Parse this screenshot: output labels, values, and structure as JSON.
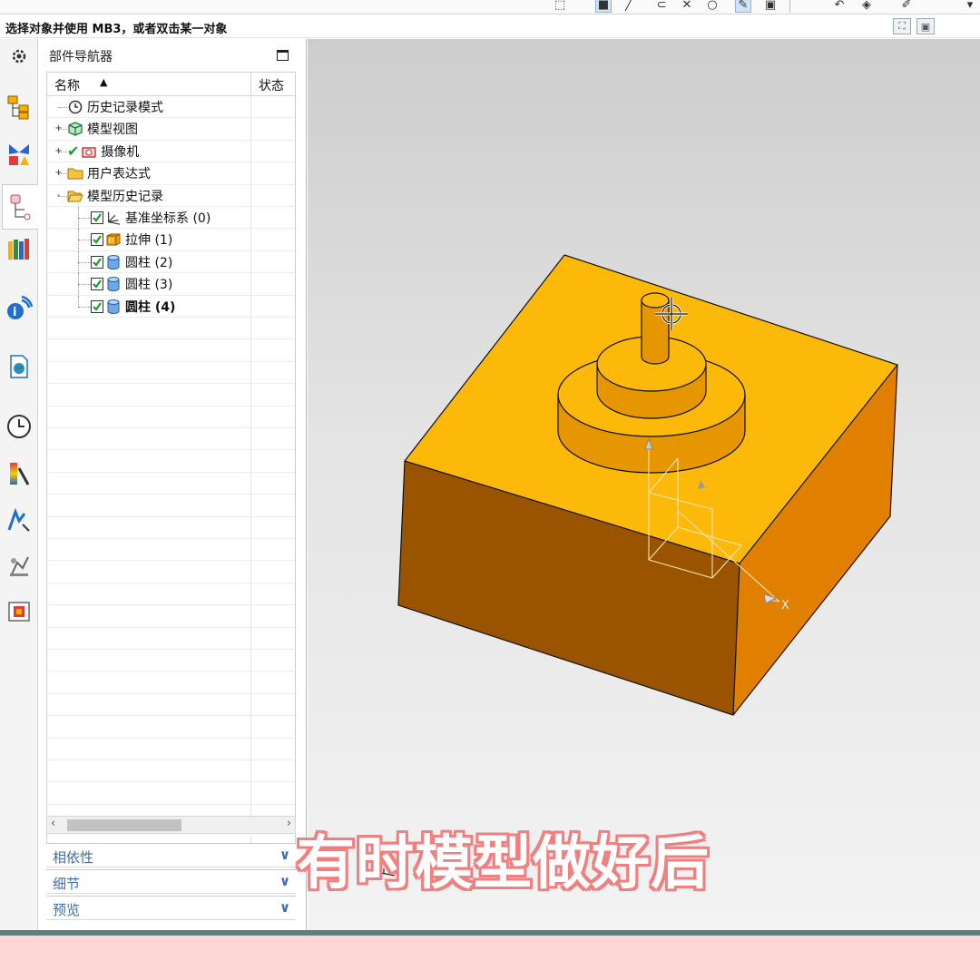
{
  "cue_line": {
    "text": "选择对象并使用 MB3，或者双击某一对象"
  },
  "resource_bar": {
    "items": [
      {
        "name": "settings-gear-icon"
      },
      {
        "name": "assembly-navigator-icon"
      },
      {
        "name": "constraint-navigator-icon"
      },
      {
        "name": "part-navigator-icon",
        "active": true
      },
      {
        "name": "reuse-library-icon"
      },
      {
        "name": "hd3d-tools-icon"
      },
      {
        "name": "web-browser-icon"
      },
      {
        "name": "history-icon"
      },
      {
        "name": "process-studio-icon"
      },
      {
        "name": "roles-icon"
      },
      {
        "name": "system-scene-icon"
      },
      {
        "name": "system-materials-icon"
      }
    ]
  },
  "navigator": {
    "title": "部件导航器",
    "header": {
      "name": "名称",
      "state": "状态"
    },
    "nodes": [
      {
        "label": "历史记录模式",
        "icon": "clock-icon",
        "depth": 0,
        "expander": "",
        "checked": null,
        "bold": false
      },
      {
        "label": "模型视图",
        "icon": "model-view-icon",
        "depth": 0,
        "expander": "+",
        "checked": null,
        "bold": false
      },
      {
        "label": "摄像机",
        "icon": "camera-icon",
        "depth": 0,
        "expander": "+",
        "checked": "tick",
        "bold": false
      },
      {
        "label": "用户表达式",
        "icon": "folder-icon",
        "depth": 0,
        "expander": "+",
        "checked": null,
        "bold": false
      },
      {
        "label": "模型历史记录",
        "icon": "folder-open-icon",
        "depth": 0,
        "expander": "-",
        "checked": null,
        "bold": false
      },
      {
        "label": "基准坐标系 (0)",
        "icon": "datum-csys-icon",
        "depth": 1,
        "expander": "",
        "checked": "box",
        "bold": false
      },
      {
        "label": "拉伸 (1)",
        "icon": "extrude-icon",
        "depth": 1,
        "expander": "",
        "checked": "box",
        "bold": false
      },
      {
        "label": "圆柱 (2)",
        "icon": "cylinder-icon",
        "depth": 1,
        "expander": "",
        "checked": "box",
        "bold": false
      },
      {
        "label": "圆柱 (3)",
        "icon": "cylinder-icon",
        "depth": 1,
        "expander": "",
        "checked": "box",
        "bold": false
      },
      {
        "label": "圆柱 (4)",
        "icon": "cylinder-icon",
        "depth": 1,
        "expander": "",
        "checked": "box",
        "bold": true
      }
    ],
    "sections": [
      {
        "label": "相依性"
      },
      {
        "label": "细节"
      },
      {
        "label": "预览"
      }
    ]
  },
  "graphics": {
    "axis_label": "X",
    "axis_label_2": "X",
    "colors": {
      "top": "#fdb90a",
      "front": "#9a5400",
      "right": "#e07f00",
      "cylinder_side": "#e69700",
      "cylinder_top": "#fdb90a"
    }
  },
  "subtitle": {
    "text": "有时模型做好后"
  }
}
